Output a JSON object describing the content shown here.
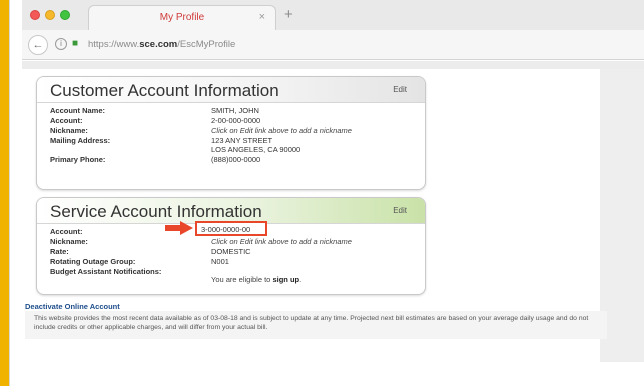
{
  "browser": {
    "tab_title": "My Profile",
    "tab_close": "×",
    "new_tab": "+",
    "url_prefix": "https://www.",
    "url_domain": "sce.com",
    "url_path": "/EscMyProfile"
  },
  "customer": {
    "title": "Customer Account Information",
    "edit": "Edit",
    "rows": [
      {
        "label": "Account Name:",
        "value": "SMITH, JOHN"
      },
      {
        "label": "Account:",
        "value": "2-00-000-0000"
      },
      {
        "label": "Nickname:",
        "value": "Click on Edit link above to add a nickname"
      },
      {
        "label": "Mailing Address:",
        "value": "123 ANY STREET",
        "value2": "LOS ANGELES, CA 90000"
      },
      {
        "label": "Primary Phone:",
        "value": "(888)000-0000"
      }
    ]
  },
  "service": {
    "title": "Service Account Information",
    "edit": "Edit",
    "rows": [
      {
        "label": "Account:",
        "value": "3-000-0000-00"
      },
      {
        "label": "Nickname:",
        "value": "Click on Edit link above to add a nickname"
      },
      {
        "label": "Rate:",
        "value": "DOMESTIC"
      },
      {
        "label": "Rotating Outage Group:",
        "value": "N001"
      },
      {
        "label": "Budget Assistant Notifications:",
        "value_prefix": "You are eligible to ",
        "value_link": "sign up",
        "value_suffix": "."
      }
    ]
  },
  "footer": {
    "deactivate": "Deactivate Online Account",
    "notice": "This website provides the most recent data available as of 03-08-18 and is subject to update at any time. Projected next bill estimates are based on your average daily usage and do not include credits or other applicable charges, and will differ from your actual bill."
  },
  "colors": {
    "accent_yellow": "#f0b400",
    "highlight_red": "#e8472a",
    "service_header_green": "#c9e2a8"
  }
}
